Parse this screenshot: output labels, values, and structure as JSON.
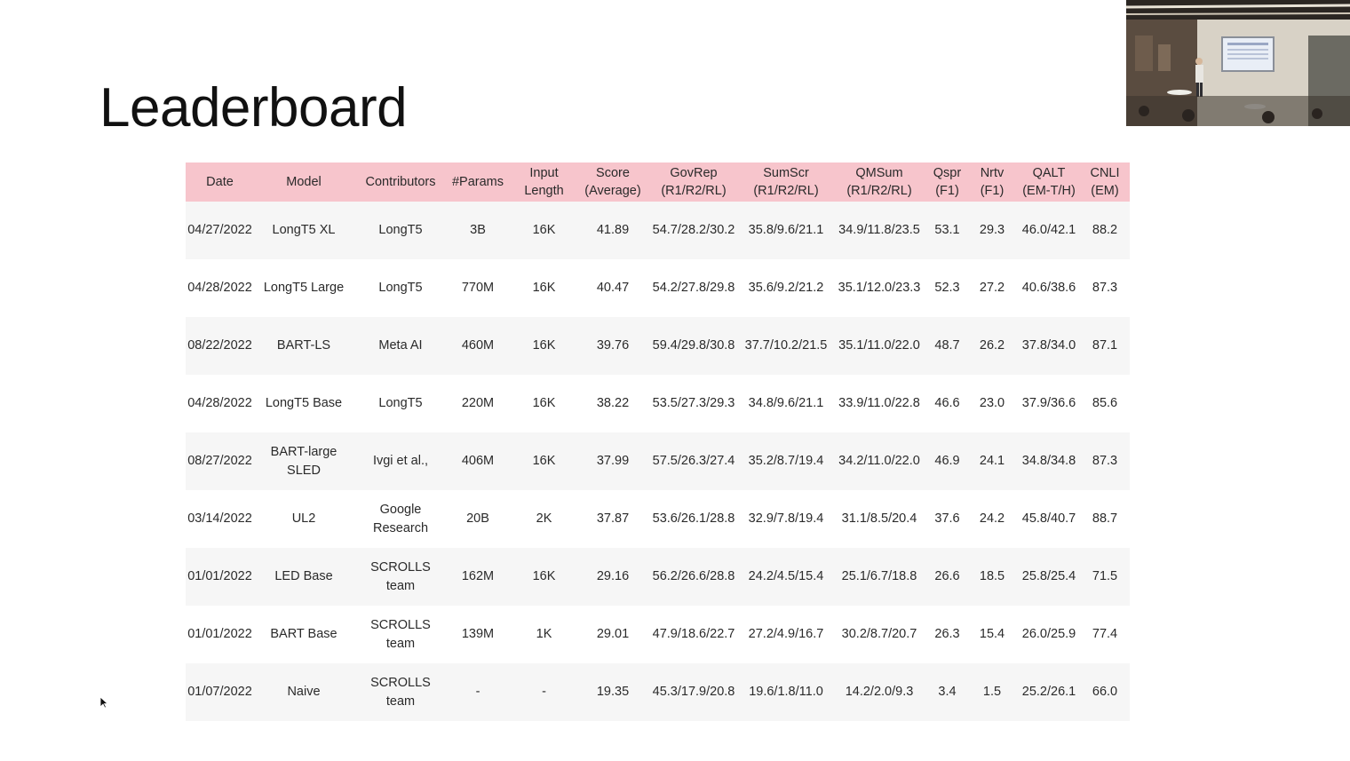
{
  "slide": {
    "title": "Leaderboard"
  },
  "table": {
    "headers": [
      "Date",
      "Model",
      "Contributors",
      "#Params",
      "Input\nLength",
      "Score\n(Average)",
      "GovRep\n(R1/R2/RL)",
      "SumScr\n(R1/R2/RL)",
      "QMSum\n(R1/R2/RL)",
      "Qspr\n(F1)",
      "Nrtv\n(F1)",
      "QALT\n(EM-T/H)",
      "CNLI\n(EM)"
    ],
    "rows": [
      [
        "04/27/2022",
        "LongT5 XL",
        "LongT5",
        "3B",
        "16K",
        "41.89",
        "54.7/28.2/30.2",
        "35.8/9.6/21.1",
        "34.9/11.8/23.5",
        "53.1",
        "29.3",
        "46.0/42.1",
        "88.2"
      ],
      [
        "04/28/2022",
        "LongT5 Large",
        "LongT5",
        "770M",
        "16K",
        "40.47",
        "54.2/27.8/29.8",
        "35.6/9.2/21.2",
        "35.1/12.0/23.3",
        "52.3",
        "27.2",
        "40.6/38.6",
        "87.3"
      ],
      [
        "08/22/2022",
        "BART-LS",
        "Meta AI",
        "460M",
        "16K",
        "39.76",
        "59.4/29.8/30.8",
        "37.7/10.2/21.5",
        "35.1/11.0/22.0",
        "48.7",
        "26.2",
        "37.8/34.0",
        "87.1"
      ],
      [
        "04/28/2022",
        "LongT5 Base",
        "LongT5",
        "220M",
        "16K",
        "38.22",
        "53.5/27.3/29.3",
        "34.8/9.6/21.1",
        "33.9/11.0/22.8",
        "46.6",
        "23.0",
        "37.9/36.6",
        "85.6"
      ],
      [
        "08/27/2022",
        "BART-large\nSLED",
        "Ivgi et al.,",
        "406M",
        "16K",
        "37.99",
        "57.5/26.3/27.4",
        "35.2/8.7/19.4",
        "34.2/11.0/22.0",
        "46.9",
        "24.1",
        "34.8/34.8",
        "87.3"
      ],
      [
        "03/14/2022",
        "UL2",
        "Google\nResearch",
        "20B",
        "2K",
        "37.87",
        "53.6/26.1/28.8",
        "32.9/7.8/19.4",
        "31.1/8.5/20.4",
        "37.6",
        "24.2",
        "45.8/40.7",
        "88.7"
      ],
      [
        "01/01/2022",
        "LED Base",
        "SCROLLS\nteam",
        "162M",
        "16K",
        "29.16",
        "56.2/26.6/28.8",
        "24.2/4.5/15.4",
        "25.1/6.7/18.8",
        "26.6",
        "18.5",
        "25.8/25.4",
        "71.5"
      ],
      [
        "01/01/2022",
        "BART Base",
        "SCROLLS\nteam",
        "139M",
        "1K",
        "29.01",
        "47.9/18.6/22.7",
        "27.2/4.9/16.7",
        "30.2/8.7/20.7",
        "26.3",
        "15.4",
        "26.0/25.9",
        "77.4"
      ],
      [
        "01/07/2022",
        "Naive",
        "SCROLLS\nteam",
        "-",
        "-",
        "19.35",
        "45.3/17.9/20.8",
        "19.6/1.8/11.0",
        "14.2/2.0/9.3",
        "3.4",
        "1.5",
        "25.2/26.1",
        "66.0"
      ]
    ]
  },
  "colors": {
    "header_bg": "#f7c5cc",
    "row_shade": "#f6f6f6"
  },
  "icons": {
    "cursor": "mouse-pointer-icon"
  }
}
